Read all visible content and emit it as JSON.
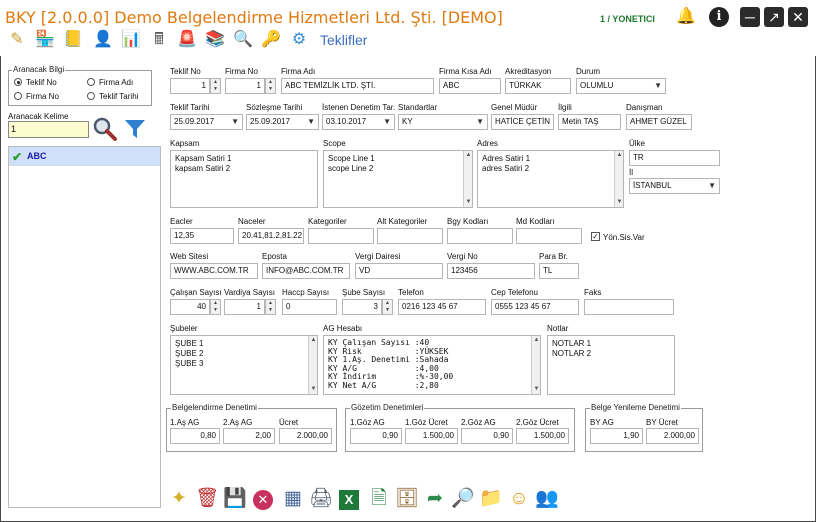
{
  "window": {
    "title": "BKY [2.0.0.0] Demo Belgelendirme Hizmetleri Ltd. Şti. [DEMO]",
    "user": "1 / YONETICI",
    "page_title": "Teklifler"
  },
  "toolbar_icons": [
    "pencil-icon",
    "shop-icon",
    "book-icon",
    "person-icon",
    "presentation-icon",
    "calculator-icon",
    "siren-icon",
    "books-icon",
    "magnifier-doc-icon",
    "key-icon",
    "gears-icon"
  ],
  "sidebar": {
    "search_group_label": "Aranacak Bilgi",
    "radios": [
      {
        "label": "Teklif No",
        "selected": true
      },
      {
        "label": "Firma Adı",
        "selected": false
      },
      {
        "label": "Firma No",
        "selected": false
      },
      {
        "label": "Teklif Tarihi",
        "selected": false
      }
    ],
    "search_label": "Aranacak Kelime",
    "search_value": "1",
    "list_items": [
      "ABC"
    ]
  },
  "form": {
    "teklif_no": {
      "label": "Teklif No",
      "value": "1"
    },
    "firma_no": {
      "label": "Firma No",
      "value": "1"
    },
    "firma_adi": {
      "label": "Firma Adı",
      "value": "ABC TEMİZLİK LTD. ŞTİ."
    },
    "firma_kisa": {
      "label": "Firma Kısa Adı",
      "value": "ABC"
    },
    "akreditasyon": {
      "label": "Akreditasyon",
      "value": "TÜRKAK"
    },
    "durum": {
      "label": "Durum",
      "value": "OLUMLU"
    },
    "teklif_tarihi": {
      "label": "Teklif Tarihi",
      "value": "25.09.2017"
    },
    "sozlesme_tarihi": {
      "label": "Sözleşme Tarihi",
      "value": "25.09.2017"
    },
    "istenen_tarih": {
      "label": "İstenen Denetim Tar.",
      "value": "03.10.2017"
    },
    "standartlar": {
      "label": "Standartlar",
      "value": "KY"
    },
    "genel_mudur": {
      "label": "Genel Müdür",
      "value": "HATİCE ÇETİN"
    },
    "ilgili": {
      "label": "İlgili",
      "value": "Metin TAŞ"
    },
    "danisman": {
      "label": "Danışman",
      "value": "AHMET GÜZEL"
    },
    "kapsam": {
      "label": "Kapsam",
      "value": "Kapsam Satiri 1\nkapsam Satiri 2"
    },
    "scope": {
      "label": "Scope",
      "value": "Scope Line 1\nscope Line 2"
    },
    "adres": {
      "label": "Adres",
      "value": "Adres Satiri 1\nadres Satiri 2"
    },
    "ulke": {
      "label": "Ülke",
      "value": "TR"
    },
    "il": {
      "label": "İl",
      "value": "İSTANBUL"
    },
    "eacler": {
      "label": "Eacler",
      "value": "12,35"
    },
    "naceler": {
      "label": "Naceler",
      "value": "20.41,81.2,81.22"
    },
    "kategoriler": {
      "label": "Kategoriler",
      "value": ""
    },
    "alt_kategoriler": {
      "label": "Alt Kategoriler",
      "value": ""
    },
    "bgy_kodlari": {
      "label": "Bgy Kodları",
      "value": ""
    },
    "md_kodlari": {
      "label": "Md Kodları",
      "value": ""
    },
    "yon_sis_var": {
      "label": "Yön.Sis.Var",
      "checked": true
    },
    "web_sitesi": {
      "label": "Web Sitesi",
      "value": "WWW.ABC.COM.TR"
    },
    "eposta": {
      "label": "Eposta",
      "value": "INFO@ABC.COM.TR"
    },
    "vergi_dairesi": {
      "label": "Vergi Dairesi",
      "value": "VD"
    },
    "vergi_no": {
      "label": "Vergi No",
      "value": "123456"
    },
    "para_br": {
      "label": "Para Br.",
      "value": "TL"
    },
    "calisan_sayisi": {
      "label": "Çalışan Sayısı",
      "value": "40"
    },
    "vardiya_sayisi": {
      "label": "Vardiya Sayısı",
      "value": "1"
    },
    "haccp_sayisi": {
      "label": "Haccp Sayısı",
      "value": "0"
    },
    "sube_sayisi": {
      "label": "Şube Sayısı",
      "value": "3"
    },
    "telefon": {
      "label": "Telefon",
      "value": "0216 123 45 67"
    },
    "cep_telefonu": {
      "label": "Cep Telefonu",
      "value": "0555 123 45 67"
    },
    "faks": {
      "label": "Faks",
      "value": ""
    },
    "subeler": {
      "label": "Şubeler",
      "value": "ŞUBE 1\nŞUBE 2\nŞUBE 3"
    },
    "ag_hesabi": {
      "label": "AG Hesabı",
      "value": "KY Çalışan Sayısı :40\nKY Risk           :YÜKSEK\nKY 1.Aş. Denetimi :Sahada\nKY A/G            :4,00\nKY İndirim        :%-30,00\nKY Net A/G        :2,80"
    },
    "notlar": {
      "label": "Notlar",
      "value": "NOTLAR 1\nNOTLAR 2"
    }
  },
  "belgelendirme": {
    "title": "Belgelendirme Denetimi",
    "cols": [
      {
        "label": "1.Aş AG",
        "value": "0,80"
      },
      {
        "label": "2.Aş AG",
        "value": "2,00"
      },
      {
        "label": "Ücret",
        "value": "2.000,00"
      }
    ]
  },
  "gozetim": {
    "title": "Gözetim Denetimleri",
    "cols": [
      {
        "label": "1.Göz AG",
        "value": "0,90"
      },
      {
        "label": "1.Göz Ücret",
        "value": "1.500,00"
      },
      {
        "label": "2.Göz AG",
        "value": "0,90"
      },
      {
        "label": "2.Göz Ücret",
        "value": "1.500,00"
      }
    ]
  },
  "yenileme": {
    "title": "Belge Yenileme Denetimi",
    "cols": [
      {
        "label": "BY AG",
        "value": "1,90"
      },
      {
        "label": "BY Ücret",
        "value": "2.000,00"
      }
    ]
  },
  "bottom_icons": [
    "new-icon",
    "delete-icon",
    "save-icon",
    "cancel-icon",
    "calculator-icon",
    "print-icon",
    "excel-icon",
    "excel-export-icon",
    "archive-icon",
    "transfer-icon",
    "search-doc-icon",
    "folder-icon",
    "support-icon",
    "users-icon"
  ]
}
